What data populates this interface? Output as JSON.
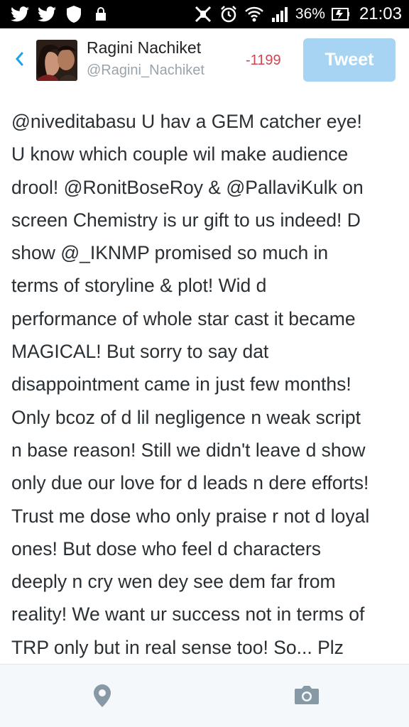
{
  "status_bar": {
    "battery_percent": "36%",
    "clock": "21:03",
    "icons": [
      "twitter-icon",
      "twitter-icon",
      "shield-icon",
      "lock-icon",
      "mute-icon",
      "alarm-icon",
      "wifi-icon",
      "signal-icon",
      "battery-icon"
    ]
  },
  "header": {
    "back_icon": "chevron-left-icon",
    "display_name": "Ragini Nachiket",
    "handle": "@Ragini_Nachiket",
    "char_count": "-1199",
    "tweet_button_label": "Tweet"
  },
  "tweet": {
    "lines": [
      "@niveditabasu U hav a GEM catcher eye!",
      "U know which couple wil make audience",
      "drool! @RonitBoseRoy & @PallaviKulk on",
      "screen Chemistry is ur gift to us indeed! D",
      "show @_IKNMP promised so much in",
      "terms of storyline & plot! Wid d",
      "performance of whole star cast it became",
      "MAGICAL! But sorry to say dat",
      "disappointment came in just few months!",
      "Only bcoz of d lil negligence n weak script",
      "n base reason! Still we didn't leave d show",
      "only due our love for d leads n dere efforts!",
      "Trust me dose who only praise r not d loyal",
      "ones! But dose who feel d characters",
      "deeply n cry wen dey see dem far from",
      "reality! We want ur success not in terms of",
      "TRP only but in real sense too! So... Plz"
    ]
  },
  "toolbar": {
    "location_icon": "location-pin-icon",
    "camera_icon": "camera-icon"
  },
  "colors": {
    "accent": "#1da1f2",
    "tweet_button_disabled": "#a6d4f2",
    "char_count_negative": "#d0454d",
    "handle": "#9aa3ab",
    "icon_gray": "#8899a6"
  }
}
